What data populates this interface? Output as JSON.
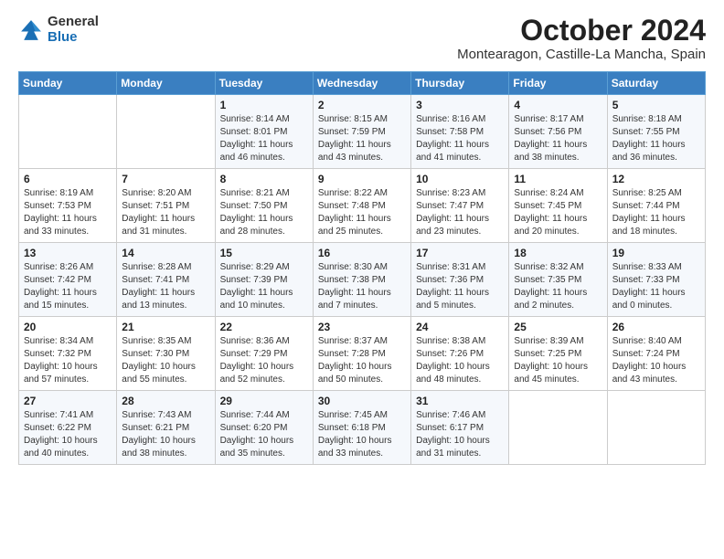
{
  "header": {
    "logo_general": "General",
    "logo_blue": "Blue",
    "title": "October 2024",
    "subtitle": "Montearagon, Castille-La Mancha, Spain"
  },
  "days_of_week": [
    "Sunday",
    "Monday",
    "Tuesday",
    "Wednesday",
    "Thursday",
    "Friday",
    "Saturday"
  ],
  "weeks": [
    [
      {
        "day": "",
        "info": ""
      },
      {
        "day": "",
        "info": ""
      },
      {
        "day": "1",
        "info": "Sunrise: 8:14 AM\nSunset: 8:01 PM\nDaylight: 11 hours and 46 minutes."
      },
      {
        "day": "2",
        "info": "Sunrise: 8:15 AM\nSunset: 7:59 PM\nDaylight: 11 hours and 43 minutes."
      },
      {
        "day": "3",
        "info": "Sunrise: 8:16 AM\nSunset: 7:58 PM\nDaylight: 11 hours and 41 minutes."
      },
      {
        "day": "4",
        "info": "Sunrise: 8:17 AM\nSunset: 7:56 PM\nDaylight: 11 hours and 38 minutes."
      },
      {
        "day": "5",
        "info": "Sunrise: 8:18 AM\nSunset: 7:55 PM\nDaylight: 11 hours and 36 minutes."
      }
    ],
    [
      {
        "day": "6",
        "info": "Sunrise: 8:19 AM\nSunset: 7:53 PM\nDaylight: 11 hours and 33 minutes."
      },
      {
        "day": "7",
        "info": "Sunrise: 8:20 AM\nSunset: 7:51 PM\nDaylight: 11 hours and 31 minutes."
      },
      {
        "day": "8",
        "info": "Sunrise: 8:21 AM\nSunset: 7:50 PM\nDaylight: 11 hours and 28 minutes."
      },
      {
        "day": "9",
        "info": "Sunrise: 8:22 AM\nSunset: 7:48 PM\nDaylight: 11 hours and 25 minutes."
      },
      {
        "day": "10",
        "info": "Sunrise: 8:23 AM\nSunset: 7:47 PM\nDaylight: 11 hours and 23 minutes."
      },
      {
        "day": "11",
        "info": "Sunrise: 8:24 AM\nSunset: 7:45 PM\nDaylight: 11 hours and 20 minutes."
      },
      {
        "day": "12",
        "info": "Sunrise: 8:25 AM\nSunset: 7:44 PM\nDaylight: 11 hours and 18 minutes."
      }
    ],
    [
      {
        "day": "13",
        "info": "Sunrise: 8:26 AM\nSunset: 7:42 PM\nDaylight: 11 hours and 15 minutes."
      },
      {
        "day": "14",
        "info": "Sunrise: 8:28 AM\nSunset: 7:41 PM\nDaylight: 11 hours and 13 minutes."
      },
      {
        "day": "15",
        "info": "Sunrise: 8:29 AM\nSunset: 7:39 PM\nDaylight: 11 hours and 10 minutes."
      },
      {
        "day": "16",
        "info": "Sunrise: 8:30 AM\nSunset: 7:38 PM\nDaylight: 11 hours and 7 minutes."
      },
      {
        "day": "17",
        "info": "Sunrise: 8:31 AM\nSunset: 7:36 PM\nDaylight: 11 hours and 5 minutes."
      },
      {
        "day": "18",
        "info": "Sunrise: 8:32 AM\nSunset: 7:35 PM\nDaylight: 11 hours and 2 minutes."
      },
      {
        "day": "19",
        "info": "Sunrise: 8:33 AM\nSunset: 7:33 PM\nDaylight: 11 hours and 0 minutes."
      }
    ],
    [
      {
        "day": "20",
        "info": "Sunrise: 8:34 AM\nSunset: 7:32 PM\nDaylight: 10 hours and 57 minutes."
      },
      {
        "day": "21",
        "info": "Sunrise: 8:35 AM\nSunset: 7:30 PM\nDaylight: 10 hours and 55 minutes."
      },
      {
        "day": "22",
        "info": "Sunrise: 8:36 AM\nSunset: 7:29 PM\nDaylight: 10 hours and 52 minutes."
      },
      {
        "day": "23",
        "info": "Sunrise: 8:37 AM\nSunset: 7:28 PM\nDaylight: 10 hours and 50 minutes."
      },
      {
        "day": "24",
        "info": "Sunrise: 8:38 AM\nSunset: 7:26 PM\nDaylight: 10 hours and 48 minutes."
      },
      {
        "day": "25",
        "info": "Sunrise: 8:39 AM\nSunset: 7:25 PM\nDaylight: 10 hours and 45 minutes."
      },
      {
        "day": "26",
        "info": "Sunrise: 8:40 AM\nSunset: 7:24 PM\nDaylight: 10 hours and 43 minutes."
      }
    ],
    [
      {
        "day": "27",
        "info": "Sunrise: 7:41 AM\nSunset: 6:22 PM\nDaylight: 10 hours and 40 minutes."
      },
      {
        "day": "28",
        "info": "Sunrise: 7:43 AM\nSunset: 6:21 PM\nDaylight: 10 hours and 38 minutes."
      },
      {
        "day": "29",
        "info": "Sunrise: 7:44 AM\nSunset: 6:20 PM\nDaylight: 10 hours and 35 minutes."
      },
      {
        "day": "30",
        "info": "Sunrise: 7:45 AM\nSunset: 6:18 PM\nDaylight: 10 hours and 33 minutes."
      },
      {
        "day": "31",
        "info": "Sunrise: 7:46 AM\nSunset: 6:17 PM\nDaylight: 10 hours and 31 minutes."
      },
      {
        "day": "",
        "info": ""
      },
      {
        "day": "",
        "info": ""
      }
    ]
  ]
}
